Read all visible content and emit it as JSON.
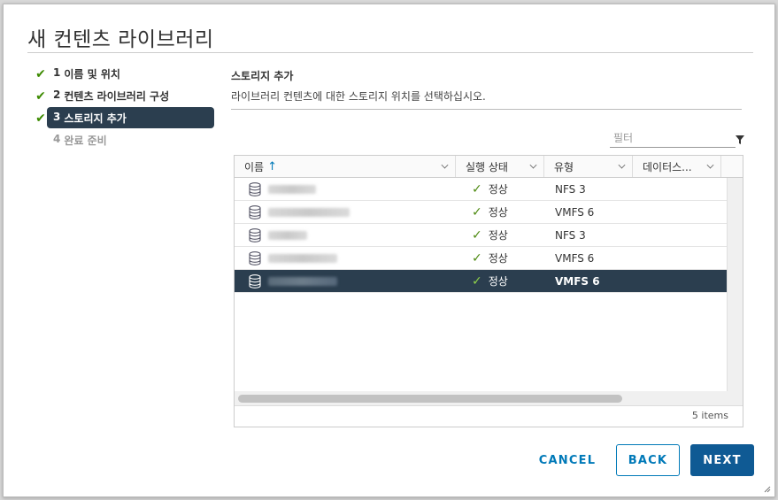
{
  "dialog": {
    "title": "새 컨텐츠 라이브러리"
  },
  "steps": [
    {
      "num": "1",
      "label": "이름 및 위치",
      "state": "done"
    },
    {
      "num": "2",
      "label": "컨텐츠 라이브러리 구성",
      "state": "done"
    },
    {
      "num": "3",
      "label": "스토리지 추가",
      "state": "active"
    },
    {
      "num": "4",
      "label": "완료 준비",
      "state": "disabled"
    }
  ],
  "section": {
    "title": "스토리지 추가",
    "description": "라이브러리 컨텐츠에 대한 스토리지 위치를 선택하십시오."
  },
  "filter": {
    "placeholder": "필터"
  },
  "table": {
    "columns": [
      "이름",
      "실행 상태",
      "유형",
      "데이터스..."
    ],
    "rows": [
      {
        "name": "",
        "status": "정상",
        "type": "NFS 3",
        "selected": false
      },
      {
        "name": "",
        "status": "정상",
        "type": "VMFS 6",
        "selected": false
      },
      {
        "name": "",
        "status": "정상",
        "type": "NFS 3",
        "selected": false
      },
      {
        "name": "",
        "status": "정상",
        "type": "VMFS 6",
        "selected": false
      },
      {
        "name": "",
        "status": "정상",
        "type": "VMFS 6",
        "selected": true
      }
    ],
    "footer": "5 items"
  },
  "buttons": {
    "cancel": "CANCEL",
    "back": "BACK",
    "next": "NEXT"
  },
  "colors": {
    "accent": "#0079b8",
    "selected_bg": "#2b3e4f",
    "ok": "#4d8a10",
    "primary": "#0f5a94"
  }
}
